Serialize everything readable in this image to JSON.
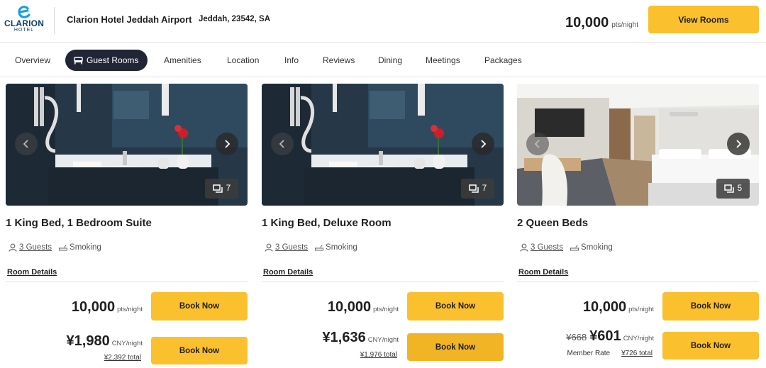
{
  "header": {
    "logo_brand": "CLARION",
    "logo_sub": "HOTEL",
    "hotel_name": "Clarion Hotel Jeddah Airport",
    "address": "Jeddah, 23542, SA",
    "points": "10,000",
    "points_unit": "pts/night",
    "view_rooms_label": "View Rooms",
    "accent_color": "#fbc02d"
  },
  "nav": {
    "items": [
      "Overview",
      "Guest Rooms",
      "Amenities",
      "Location",
      "Info",
      "Reviews",
      "Dining",
      "Meetings",
      "Packages"
    ],
    "active": "Guest Rooms"
  },
  "rooms": [
    {
      "title": "1 King Bed, 1 Bedroom Suite",
      "photo_count": "7",
      "guests": "3 Guests",
      "smoking": "Smoking",
      "details_label": "Room Details",
      "points": "10,000",
      "points_unit": "pts/night",
      "book_label": "Book Now",
      "old_price": "",
      "cash": "¥1,980",
      "cash_unit": "CNY/night",
      "member_label": "",
      "total": "¥2,392 total"
    },
    {
      "title": "1 King Bed, Deluxe Room",
      "photo_count": "7",
      "guests": "3 Guests",
      "smoking": "Smoking",
      "details_label": "Room Details",
      "points": "10,000",
      "points_unit": "pts/night",
      "book_label": "Book Now",
      "old_price": "",
      "cash": "¥1,636",
      "cash_unit": "CNY/night",
      "member_label": "",
      "total": "¥1,976 total"
    },
    {
      "title": "2 Queen Beds",
      "photo_count": "5",
      "guests": "3 Guests",
      "smoking": "Smoking",
      "details_label": "Room Details",
      "points": "10,000",
      "points_unit": "pts/night",
      "book_label": "Book Now",
      "old_price": "¥668",
      "cash": "¥601",
      "cash_unit": "CNY/night",
      "member_label": "Member Rate",
      "total": "¥726 total"
    }
  ]
}
